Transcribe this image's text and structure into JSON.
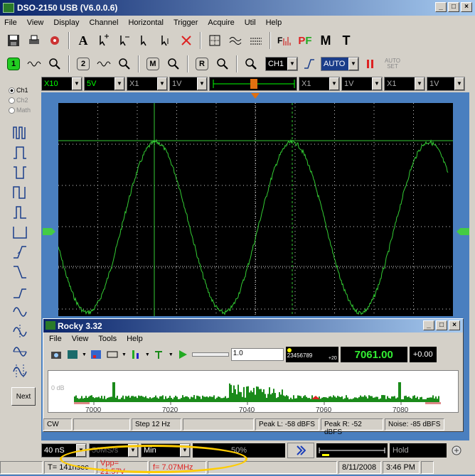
{
  "window": {
    "title": "DSO-2150 USB (V6.0.0.6)",
    "min": "_",
    "max": "□",
    "close": "×"
  },
  "menu": [
    "File",
    "View",
    "Display",
    "Channel",
    "Horizontal",
    "Trigger",
    "Acquire",
    "Util",
    "Help"
  ],
  "toolbar1": [
    "A",
    "PF",
    "M",
    "T"
  ],
  "toolbar2": {
    "btn1": "1",
    "btn2": "2",
    "btnM": "M",
    "btnR": "R",
    "channel": "CH1",
    "mode": "AUTO",
    "autoset": "AUTO SET"
  },
  "vertical": {
    "ch1_probe": "X10",
    "ch1_volts": "5V",
    "ch2_probe": "X1",
    "ch2_volts": "1V",
    "probe3": "X1",
    "volts3": "1V",
    "probe4": "X1",
    "volts4": "1V"
  },
  "left_panel": {
    "radios": [
      "Ch1",
      "Ch2",
      "Math"
    ],
    "next": "Next"
  },
  "rocky": {
    "title": "Rocky 3.32",
    "menu": [
      "File",
      "View",
      "Tools",
      "Help"
    ],
    "zoom": "1.0",
    "digits": "23456789",
    "digits_suffix": "+20",
    "frequency": "7061.00",
    "offset": "+0.00",
    "db_label": "0 dB",
    "ticks": [
      "7000",
      "7020",
      "7040",
      "7060",
      "7080"
    ],
    "status": {
      "mode": "CW",
      "step": "Step 12 Hz",
      "peak_l": "Peak L: -58 dBFS",
      "peak_r": "Peak R: -52 dBFS",
      "noise": "Noise: -85 dBFS"
    }
  },
  "bottom": {
    "timebase": "40 nS",
    "samplerate": "50MS/s",
    "acq": "Min",
    "position": "50%",
    "state": "Hold"
  },
  "status": {
    "period": "T= 141nsec",
    "vpp": "Vpp= 21.57V",
    "freq": "f= 7.07MHz",
    "date": "8/11/2008",
    "time": "3:46 PM"
  },
  "colors": {
    "trace": "#33cc33",
    "grid": "#cfcfcf",
    "accent": "#ffcc00"
  }
}
